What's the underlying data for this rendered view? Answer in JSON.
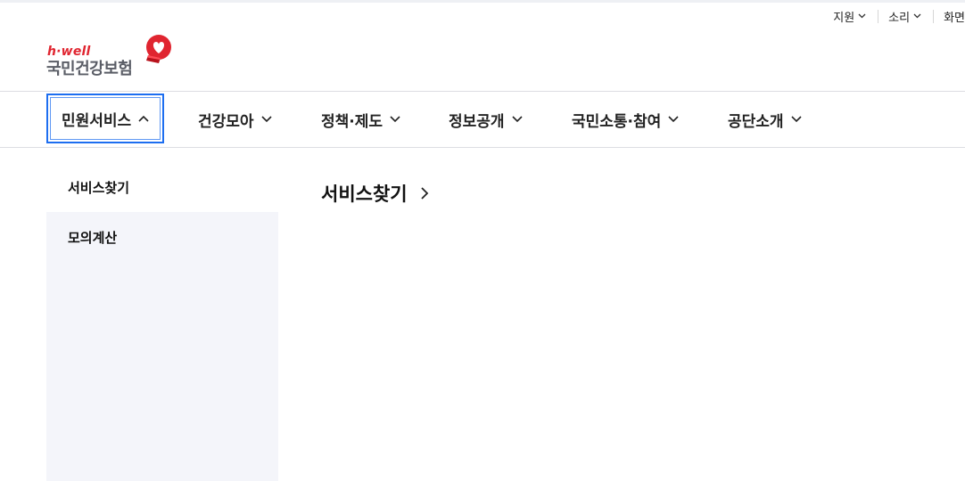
{
  "utility": {
    "items": [
      {
        "label": "지원"
      },
      {
        "label": "소리"
      },
      {
        "label": "화면"
      }
    ]
  },
  "logo": {
    "tagline": "h·well",
    "name": "국민건강보험",
    "icon": "heart-logo-icon",
    "brand_color": "#e02530"
  },
  "gnb": {
    "items": [
      {
        "label": "민원서비스",
        "expanded": true
      },
      {
        "label": "건강모아",
        "expanded": false
      },
      {
        "label": "정책·제도",
        "expanded": false
      },
      {
        "label": "정보공개",
        "expanded": false
      },
      {
        "label": "국민소통·참여",
        "expanded": false
      },
      {
        "label": "공단소개",
        "expanded": false
      }
    ],
    "focus_color": "#1d6ef0"
  },
  "sidebar": {
    "items": [
      {
        "label": "서비스찾기",
        "active": true
      },
      {
        "label": "모의계산",
        "active": false
      }
    ]
  },
  "content": {
    "title": "서비스찾기",
    "title_icon": "chevron-right-icon"
  }
}
